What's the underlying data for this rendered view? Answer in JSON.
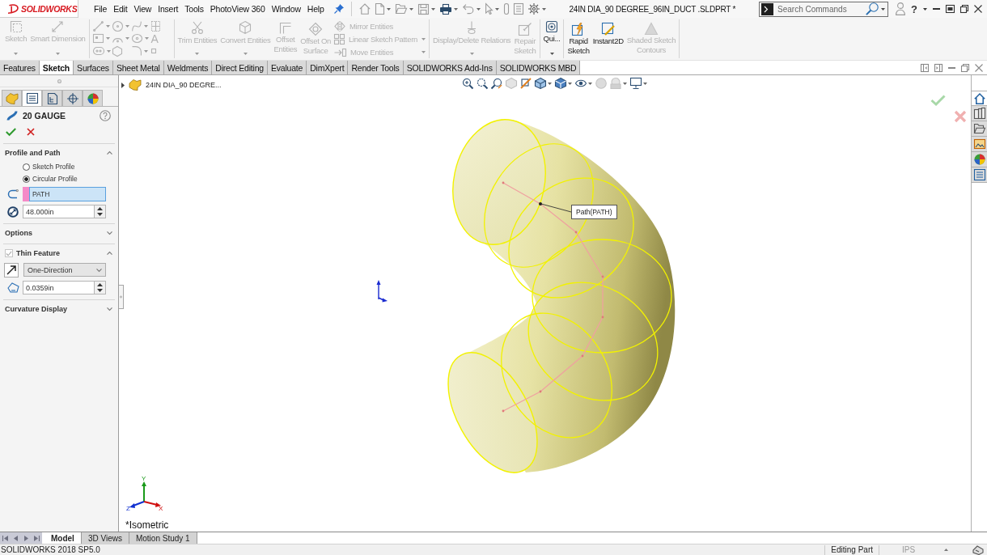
{
  "title_bar": {
    "logo": "SOLIDWORKS",
    "menu": [
      "File",
      "Edit",
      "View",
      "Insert",
      "Tools",
      "PhotoView 360",
      "Window",
      "Help"
    ],
    "document_title": "24IN DIA_90 DEGREE_96IN_DUCT .SLDPRT *",
    "search": {
      "placeholder": "Search Commands"
    },
    "help": "?"
  },
  "ribbon": {
    "groups": [
      {
        "kind": "commands",
        "commands": [
          {
            "kind": "dropdown",
            "label": "Sketch",
            "disabled": true
          },
          {
            "kind": "dropdown",
            "label": "Smart Dimension",
            "disabled": true
          }
        ]
      },
      {
        "kind": "tool_grid",
        "glyph": "A",
        "disabled": true
      },
      {
        "kind": "commands",
        "commands": [
          {
            "kind": "dropdown",
            "label": "Trim Entities",
            "disabled": true
          },
          {
            "kind": "dropdown",
            "label": "Convert Entities",
            "disabled": true
          },
          {
            "kind": "button",
            "label": "Offset\nEntities",
            "disabled": true
          },
          {
            "kind": "button",
            "label": "Offset On\nSurface",
            "disabled": true
          },
          {
            "kind": "stack",
            "items": [
              {
                "label": "Mirror Entities",
                "disabled": true,
                "dropdown": false
              },
              {
                "label": "Linear Sketch Pattern",
                "disabled": true,
                "dropdown": true
              },
              {
                "label": "Move Entities",
                "disabled": true,
                "dropdown": true
              }
            ]
          }
        ]
      },
      {
        "kind": "commands",
        "commands": [
          {
            "kind": "dropdown",
            "label": "Display/Delete Relations",
            "disabled": true
          },
          {
            "kind": "button",
            "label": "Repair\nSketch",
            "disabled": true
          }
        ]
      },
      {
        "kind": "commands",
        "commands": [
          {
            "kind": "dropdown",
            "label": "Qui...",
            "disabled": false
          }
        ]
      },
      {
        "kind": "commands",
        "commands": [
          {
            "kind": "button",
            "label": "Rapid\nSketch",
            "disabled": false
          },
          {
            "kind": "button",
            "label": "Instant2D",
            "disabled": false
          },
          {
            "kind": "button",
            "label": "Shaded Sketch\nContours",
            "disabled": true
          }
        ]
      }
    ]
  },
  "command_tabs": [
    {
      "label": "Features",
      "selected": false
    },
    {
      "label": "Sketch",
      "selected": true
    },
    {
      "label": "Surfaces",
      "selected": false
    },
    {
      "label": "Sheet Metal",
      "selected": false
    },
    {
      "label": "Weldments",
      "selected": false
    },
    {
      "label": "Direct Editing",
      "selected": false
    },
    {
      "label": "Evaluate",
      "selected": false
    },
    {
      "label": "DimXpert",
      "selected": false
    },
    {
      "label": "Render Tools",
      "selected": false
    },
    {
      "label": "SOLIDWORKS Add-Ins",
      "selected": false
    },
    {
      "label": "SOLIDWORKS MBD",
      "selected": false
    }
  ],
  "property_manager": {
    "tabs": [
      {
        "selected": false
      },
      {
        "selected": true
      },
      {
        "selected": false
      },
      {
        "selected": false
      },
      {
        "selected": false
      }
    ],
    "title": "20 GAUGE",
    "sections": [
      {
        "title": "Profile and Path",
        "expanded": true,
        "controls": [
          {
            "kind": "radio",
            "label": "Sketch Profile",
            "selected": false
          },
          {
            "kind": "radio",
            "label": "Circular Profile",
            "selected": true
          },
          {
            "kind": "selection",
            "value": "PATH",
            "color": "#f58ac8",
            "active": true
          },
          {
            "kind": "spin",
            "value": "48.000in"
          }
        ]
      },
      {
        "title": "Options",
        "expanded": false
      },
      {
        "title": "Thin Feature",
        "expanded": true,
        "checked": true,
        "controls": [
          {
            "kind": "dropdown",
            "value": "One-Direction"
          },
          {
            "kind": "spin",
            "value": "0.0359in"
          }
        ]
      },
      {
        "title": "Curvature Display",
        "expanded": false
      }
    ]
  },
  "viewport": {
    "breadcrumb": "24IN DIA_90 DEGRE...",
    "callout": "Path(PATH)",
    "triad": {
      "x": "X",
      "y": "Y",
      "z": "Z"
    },
    "view_name": "*Isometric"
  },
  "task_pane": [
    {
      "selected": true
    },
    {
      "selected": false
    },
    {
      "selected": false
    },
    {
      "selected": false
    },
    {
      "selected": false
    },
    {
      "selected": false
    }
  ],
  "bottom_tabs": [
    {
      "label": "Model",
      "selected": true
    },
    {
      "label": "3D Views",
      "selected": false
    },
    {
      "label": "Motion Study 1",
      "selected": false
    }
  ],
  "status_bar": {
    "version": "SOLIDWORKS 2018 SP5.0",
    "mode": "Editing Part",
    "units": "IPS"
  }
}
